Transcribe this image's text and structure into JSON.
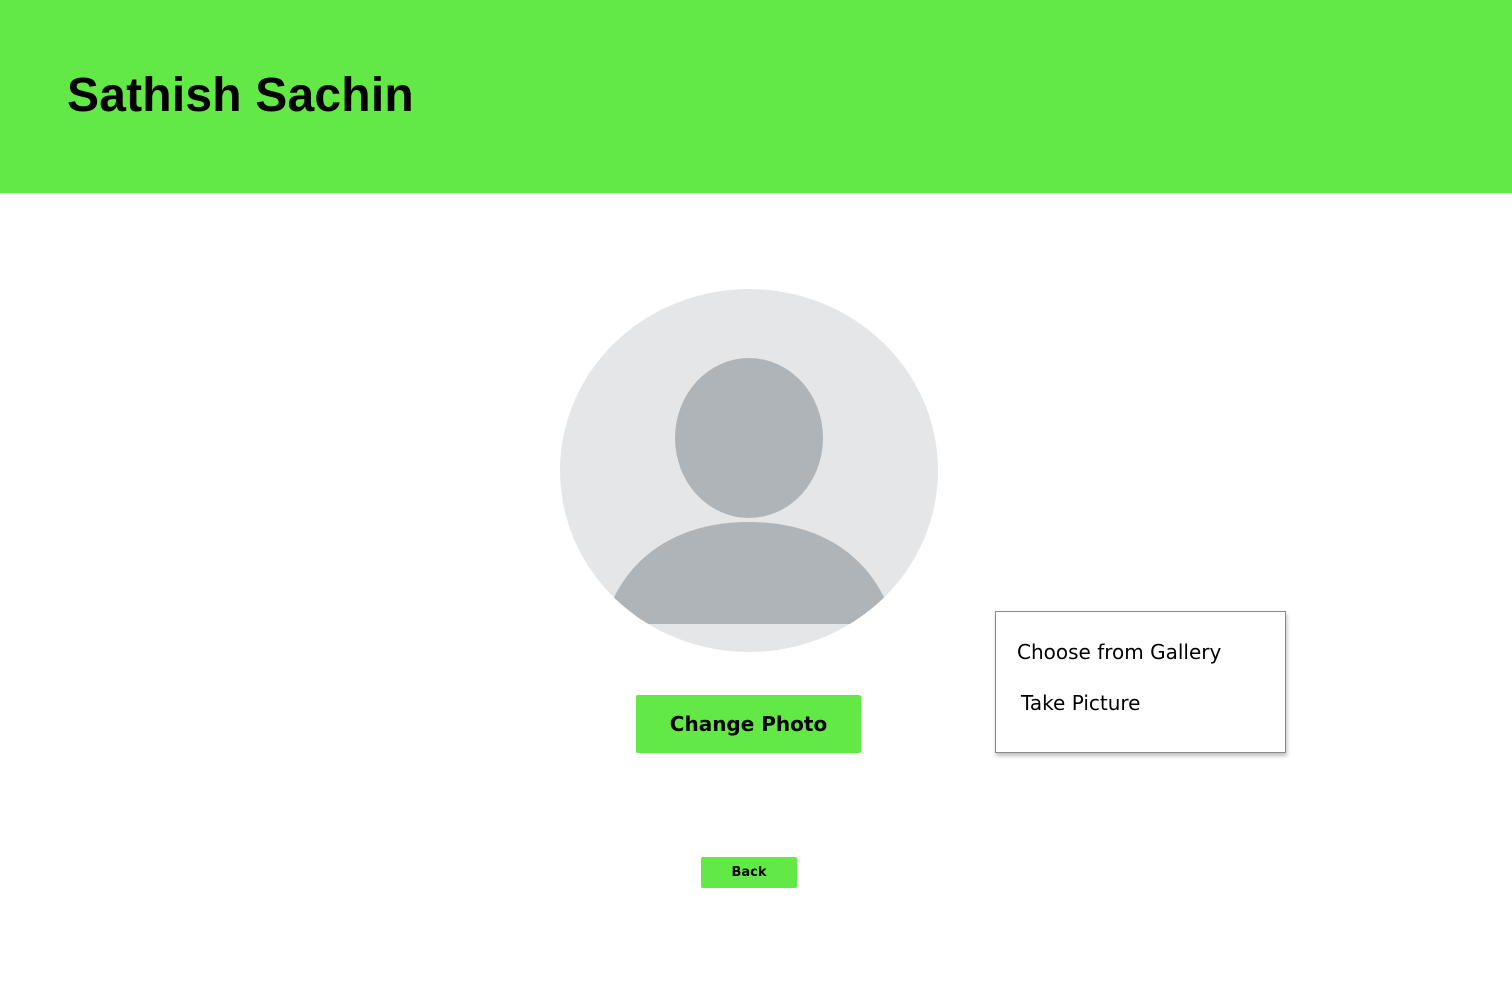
{
  "header": {
    "title": "Sathish Sachin",
    "background_color": "#63e945"
  },
  "avatar": {
    "icon": "user-placeholder-icon",
    "background_color": "#e5e6e8",
    "silhouette_color": "#afb4b8"
  },
  "actions": {
    "change_photo_label": "Change Photo",
    "back_label": "Back",
    "button_color": "#63e945"
  },
  "photo_menu": {
    "items": [
      {
        "label": "Choose from Gallery"
      },
      {
        "label": "Take Picture"
      }
    ]
  }
}
